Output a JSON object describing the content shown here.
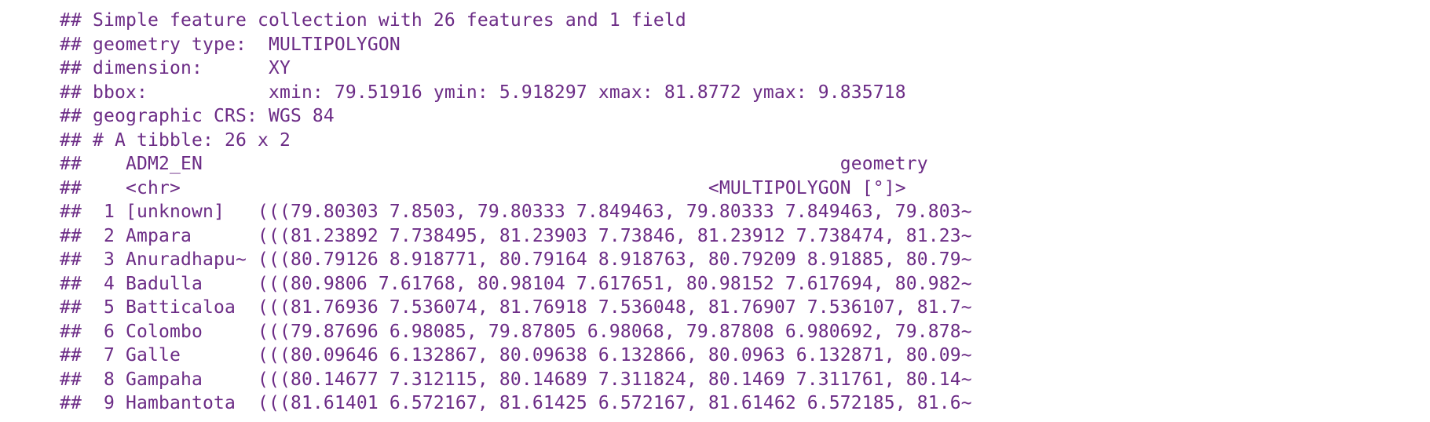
{
  "output": {
    "lines": [
      "## Simple feature collection with 26 features and 1 field",
      "## geometry type:  MULTIPOLYGON",
      "## dimension:      XY",
      "## bbox:           xmin: 79.51916 ymin: 5.918297 xmax: 81.8772 ymax: 9.835718",
      "## geographic CRS: WGS 84",
      "## # A tibble: 26 x 2",
      "##    ADM2_EN                                                          geometry",
      "##    <chr>                                                <MULTIPOLYGON [°]>",
      "##  1 [unknown]   (((79.80303 7.8503, 79.80333 7.849463, 79.80333 7.849463, 79.803~",
      "##  2 Ampara      (((81.23892 7.738495, 81.23903 7.73846, 81.23912 7.738474, 81.23~",
      "##  3 Anuradhapu~ (((80.79126 8.918771, 80.79164 8.918763, 80.79209 8.91885, 80.79~",
      "##  4 Badulla     (((80.9806 7.61768, 80.98104 7.617651, 80.98152 7.617694, 80.982~",
      "##  5 Batticaloa  (((81.76936 7.536074, 81.76918 7.536048, 81.76907 7.536107, 81.7~",
      "##  6 Colombo     (((79.87696 6.98085, 79.87805 6.98068, 79.87808 6.980692, 79.878~",
      "##  7 Galle       (((80.09646 6.132867, 80.09638 6.132866, 80.0963 6.132871, 80.09~",
      "##  8 Gampaha     (((80.14677 7.312115, 80.14689 7.311824, 80.1469 7.311761, 80.14~",
      "##  9 Hambantota  (((81.61401 6.572167, 81.61425 6.572167, 81.61462 6.572185, 81.6~"
    ]
  },
  "colors": {
    "text": "#6c2c86",
    "background": "#ffffff"
  }
}
